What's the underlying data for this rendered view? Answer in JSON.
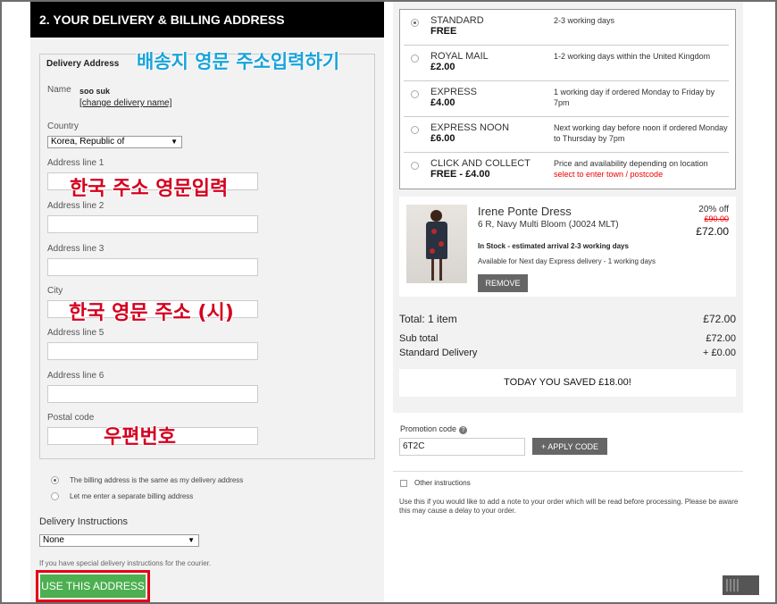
{
  "left": {
    "header": "2. YOUR DELIVERY & BILLING ADDRESS",
    "legend": "Delivery Address",
    "annotation_top": "배송지 영문 주소입력하기",
    "name_label": "Name",
    "name_value": "soo suk",
    "change_link": "[change delivery name]",
    "country_label": "Country",
    "country_value": "Korea, Republic of",
    "address1_label": "Address line 1",
    "annotation_address1": "한국 주소 영문입력",
    "address2_label": "Address line 2",
    "address3_label": "Address line 3",
    "city_label": "City",
    "annotation_city": "한국 영문 주소 (시)",
    "address5_label": "Address line 5",
    "address6_label": "Address line 6",
    "postal_label": "Postal code",
    "annotation_postal": "우편번호",
    "billing_same": "The billing address is the same as my delivery address",
    "billing_separate": "Let me enter a separate billing address",
    "instructions_label": "Delivery Instructions",
    "instructions_value": "None",
    "instructions_help": "If you have special delivery instructions for the courier.",
    "use_button": "USE THIS ADDRESS"
  },
  "shipping": {
    "options": [
      {
        "name": "STANDARD",
        "price": "FREE",
        "desc": "2-3 working days",
        "note": "",
        "selected": true
      },
      {
        "name": "ROYAL MAIL",
        "price": "£2.00",
        "desc": "1-2 working days within the United Kingdom",
        "note": "",
        "selected": false
      },
      {
        "name": "EXPRESS",
        "price": "£4.00",
        "desc": "1 working day if ordered Monday to Friday by 7pm",
        "note": "",
        "selected": false
      },
      {
        "name": "EXPRESS NOON",
        "price": "£6.00",
        "desc": "Next working day before noon if ordered Monday to Thursday by 7pm",
        "note": "",
        "selected": false
      },
      {
        "name": "CLICK AND COLLECT",
        "price": "FREE - £4.00",
        "desc": "Price and availability depending on location",
        "note": "select to enter town / postcode",
        "selected": false
      }
    ]
  },
  "product": {
    "title": "Irene Ponte Dress",
    "sub": "6 R, Navy Multi Bloom (J0024 MLT)",
    "stock": "In Stock - estimated arrival 2-3 working days",
    "avail": "Available for Next day Express delivery - 1 working days",
    "discount": "20% off",
    "old_price": "£90.00",
    "price": "£72.00",
    "remove": "REMOVE"
  },
  "totals": {
    "total_label": "Total: 1 item",
    "total_value": "£72.00",
    "subtotal_label": "Sub total",
    "subtotal_value": "£72.00",
    "delivery_label": "Standard Delivery",
    "delivery_value": "+ £0.00",
    "saved": "TODAY YOU SAVED £18.00!"
  },
  "promo": {
    "label": "Promotion code",
    "value": "6T2C",
    "apply": "+ APPLY CODE"
  },
  "other": {
    "label": "Other instructions",
    "help": "Use this if you would like to add a note to your order which will be read before processing. Please be aware this may cause a delay to your order."
  },
  "colors": {
    "accent_green": "#4caf50",
    "annotation_red": "#d4001f",
    "annotation_blue": "#19a3d9"
  }
}
